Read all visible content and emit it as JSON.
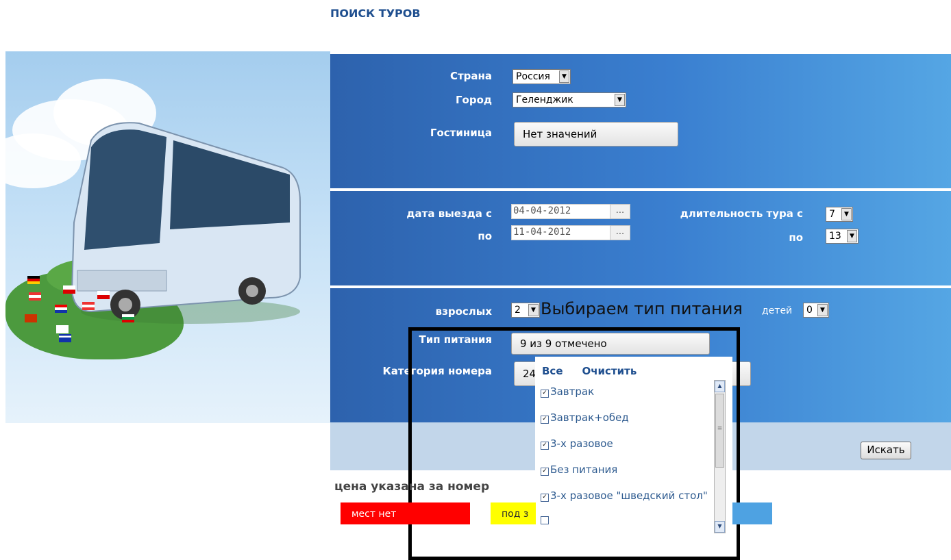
{
  "page_title": "ПОИСК ТУРОВ",
  "form": {
    "country": {
      "label": "Страна",
      "value": "Россия"
    },
    "city": {
      "label": "Город",
      "value": "Геленджик"
    },
    "hotel": {
      "label": "Гостиница",
      "value": "Нет значений"
    },
    "date_from": {
      "label": "дата выезда с",
      "value": "04-04-2012",
      "button": "..."
    },
    "date_to": {
      "label": "по",
      "value": "11-04-2012",
      "button": "..."
    },
    "duration_from": {
      "label": "длительность тура с",
      "value": "7"
    },
    "duration_to": {
      "label": "по",
      "value": "13"
    },
    "adults": {
      "label": "взрослых",
      "value": "2"
    },
    "children": {
      "label": "детей",
      "value": "0"
    },
    "meal_type": {
      "label": "Тип питания",
      "value": "9 из 9 отмечено"
    },
    "room_category": {
      "label": "Категория номера",
      "value": "24"
    },
    "search_button": "Искать"
  },
  "annotation": "Выбираем тип питания",
  "meal_dropdown": {
    "select_all": "Все",
    "clear": "Очистить",
    "items": [
      {
        "label": "Завтрак",
        "checked": true
      },
      {
        "label": "Завтрак+обед",
        "checked": true
      },
      {
        "label": "3-х разовое",
        "checked": true
      },
      {
        "label": "Без питания",
        "checked": true
      },
      {
        "label": "3-х разовое \"шведский стол\"",
        "checked": true
      }
    ]
  },
  "price_note": "цена указана за номер",
  "legend": {
    "no_places": "мест нет",
    "on_request": "под з"
  },
  "colors": {
    "title": "#1f4f8f",
    "panel_start": "#2d62ad",
    "panel_end": "#55a6e4",
    "legend_red": "#ff0000",
    "legend_yellow": "#ffff00",
    "legend_blue": "#4ea2e2"
  },
  "icons": {
    "dropdown_arrow": "chevron-down-icon",
    "checkbox": "checkbox-checked-icon",
    "scroll_up": "scroll-up-icon",
    "scroll_down": "scroll-down-icon"
  }
}
